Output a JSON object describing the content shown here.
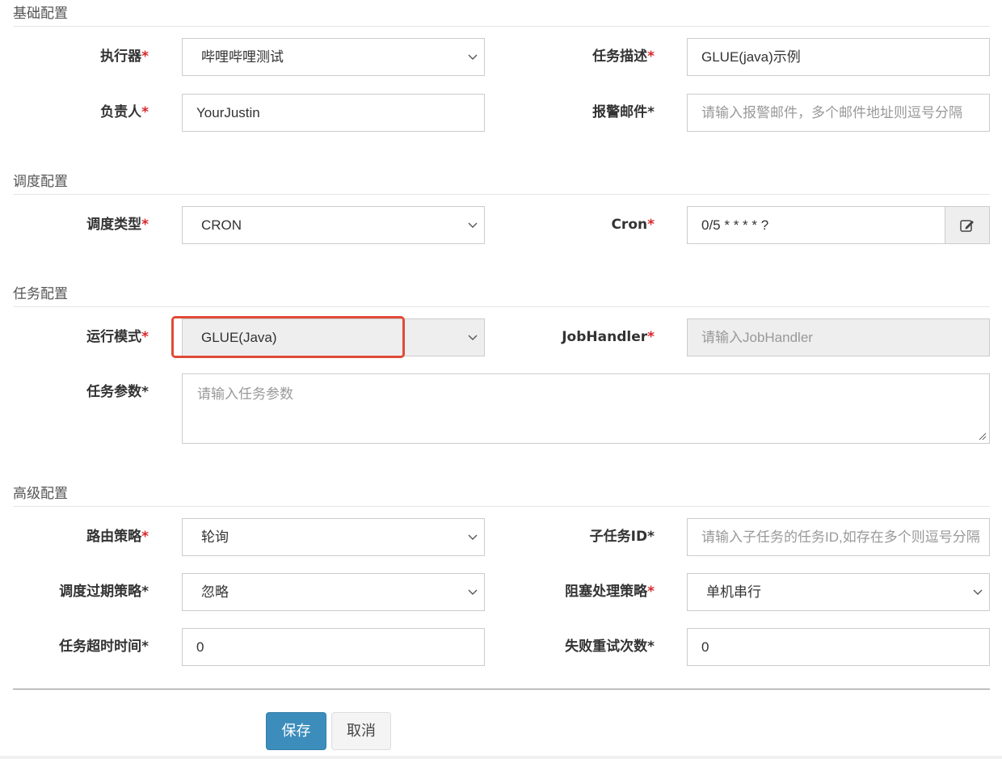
{
  "sections": {
    "basic": "基础配置",
    "schedule": "调度配置",
    "task": "任务配置",
    "advanced": "高级配置"
  },
  "basic": {
    "executor": {
      "label": "执行器",
      "value": "哔哩哔哩测试"
    },
    "job_desc": {
      "label": "任务描述",
      "value": "GLUE(java)示例"
    },
    "author": {
      "label": "负责人",
      "value": "YourJustin"
    },
    "alarm_email": {
      "label": "报警邮件",
      "placeholder": "请输入报警邮件，多个邮件地址则逗号分隔"
    }
  },
  "schedule": {
    "schedule_type": {
      "label": "调度类型",
      "value": "CRON"
    },
    "cron": {
      "label": "Cron",
      "value": "0/5 * * * * ?"
    }
  },
  "task": {
    "glue_type": {
      "label": "运行模式",
      "value": "GLUE(Java)"
    },
    "job_handler": {
      "label": "JobHandler",
      "placeholder": "请输入JobHandler"
    },
    "job_param": {
      "label": "任务参数",
      "placeholder": "请输入任务参数"
    }
  },
  "advanced": {
    "route_strategy": {
      "label": "路由策略",
      "value": "轮询"
    },
    "child_job_id": {
      "label": "子任务ID",
      "placeholder": "请输入子任务的任务ID,如存在多个则逗号分隔"
    },
    "misfire_strategy": {
      "label": "调度过期策略",
      "value": "忽略"
    },
    "block_strategy": {
      "label": "阻塞处理策略",
      "value": "单机串行"
    },
    "timeout": {
      "label": "任务超时时间",
      "value": "0"
    },
    "fail_retry": {
      "label": "失败重试次数",
      "value": "0"
    }
  },
  "buttons": {
    "save": "保存",
    "cancel": "取消"
  },
  "required_mark": "*",
  "colors": {
    "required": "#d9262a",
    "primary": "#3c8dbc",
    "highlight_box": "#e04b36"
  },
  "icons": {
    "dropdown": "chevron-down-icon",
    "cron_edit": "edit-icon",
    "resize": "resize-handle-icon"
  }
}
